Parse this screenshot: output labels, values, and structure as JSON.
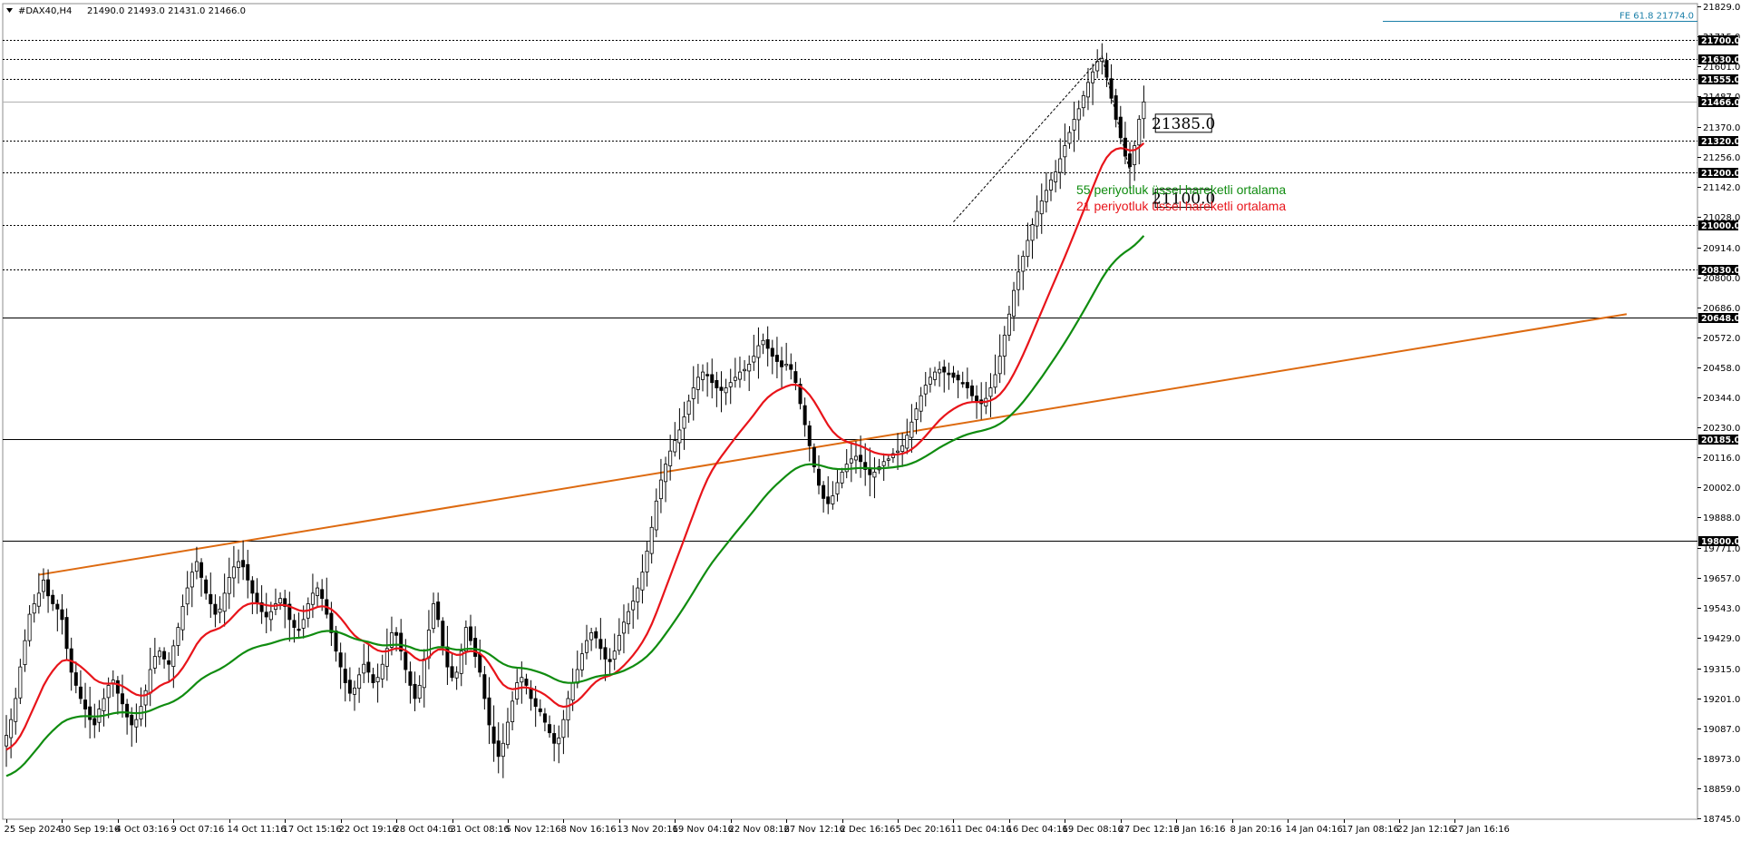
{
  "header": {
    "symbol": "#DAX40,H4",
    "ohlc": "21490.0 21493.0 21431.0 21466.0",
    "collapse_icon": "triangle-down-icon"
  },
  "colors": {
    "ema21": "#e8141a",
    "ema55": "#108c10",
    "trendline": "#dd6a10",
    "fe_line": "#1a7fa8",
    "candle": "#000000",
    "price_box": "#000000"
  },
  "legend": {
    "ema55_label": "55 periyotluk üssel hareketli ortalama",
    "ema21_label": "21 periyotluk üssel hareketli ortalama"
  },
  "annotations": {
    "fe_label": "FE 61.8 21774.0",
    "box_upper": "21385.0",
    "box_lower": "21100.0"
  },
  "chart_data": {
    "type": "candlestick",
    "symbol": "#DAX40",
    "timeframe": "H4",
    "last": {
      "open": 21490.0,
      "high": 21493.0,
      "low": 21431.0,
      "close": 21466.0
    },
    "y_axis": {
      "min": 18745,
      "max": 18829,
      "range": [
        18745.0,
        21829.0
      ],
      "ticks": [
        "21829.0",
        "21715.0",
        "21601.0",
        "21487.0",
        "21370.0",
        "21256.0",
        "21142.0",
        "21028.0",
        "20914.0",
        "20800.0",
        "20686.0",
        "20572.0",
        "20458.0",
        "20344.0",
        "20230.0",
        "20116.0",
        "20002.0",
        "19888.0",
        "19771.0",
        "19657.0",
        "19543.0",
        "19429.0",
        "19315.0",
        "19201.0",
        "19087.0",
        "18973.0",
        "18859.0",
        "18745.0"
      ],
      "tick_values": [
        21829.0,
        21715.0,
        21601.0,
        21487.0,
        21370.0,
        21256.0,
        21142.0,
        21028.0,
        20914.0,
        20800.0,
        20686.0,
        20572.0,
        20458.0,
        20344.0,
        20230.0,
        20116.0,
        20002.0,
        19888.0,
        19771.0,
        19657.0,
        19543.0,
        19429.0,
        19315.0,
        19201.0,
        19087.0,
        18973.0,
        18859.0,
        18745.0
      ]
    },
    "x_axis": {
      "ticks": [
        "25 Sep 2024",
        "30 Sep 19:16",
        "4 Oct 03:16",
        "9 Oct 07:16",
        "14 Oct 11:16",
        "17 Oct 15:16",
        "22 Oct 19:16",
        "28 Oct 04:16",
        "31 Oct 08:16",
        "5 Nov 12:16",
        "8 Nov 16:16",
        "13 Nov 20:16",
        "19 Nov 04:16",
        "22 Nov 08:16",
        "27 Nov 12:16",
        "2 Dec 16:16",
        "5 Dec 20:16",
        "11 Dec 04:16",
        "16 Dec 04:16",
        "19 Dec 08:16",
        "27 Dec 12:16",
        "3 Jan 16:16",
        "8 Jan 20:16",
        "14 Jan 04:16",
        "17 Jan 08:16",
        "22 Jan 12:16",
        "27 Jan 16:16"
      ],
      "tick_bars": [
        0,
        12,
        24,
        36,
        48,
        60,
        72,
        84,
        96,
        108,
        120,
        132,
        144,
        156,
        168,
        180,
        192,
        204,
        216,
        228,
        240,
        252,
        264,
        276,
        288,
        300,
        312
      ]
    },
    "horizontal_levels": [
      {
        "label": "21700.0",
        "value": 21700.0,
        "style": "dotted"
      },
      {
        "label": "21630.0",
        "value": 21630.0,
        "style": "dotted"
      },
      {
        "label": "21555.0",
        "value": 21555.0,
        "style": "dotted"
      },
      {
        "label": "21466.0",
        "value": 21466.0,
        "style": "current-price"
      },
      {
        "label": "21320.0",
        "value": 21320.0,
        "style": "dotted"
      },
      {
        "label": "21200.0",
        "value": 21200.0,
        "style": "dotted"
      },
      {
        "label": "21000.0",
        "value": 21000.0,
        "style": "dotted"
      },
      {
        "label": "20830.0",
        "value": 20830.0,
        "style": "dotted"
      },
      {
        "label": "20648.0",
        "value": 20648.0,
        "style": "solid"
      },
      {
        "label": "20185.0",
        "value": 20185.0,
        "style": "solid"
      },
      {
        "label": "19800.0",
        "value": 19800.0,
        "style": "solid"
      }
    ],
    "fibonacci_extension": {
      "label": "FE 61.8 21774.0",
      "value": 21774.0
    },
    "trendline": {
      "from": {
        "bar": 7,
        "price": 19670
      },
      "to": {
        "bar": 349,
        "price": 20660
      }
    },
    "boxed_labels": [
      {
        "text": "21385.0",
        "value": 21385.0
      },
      {
        "text": "21100.0",
        "value": 21100.0
      }
    ],
    "indicators": [
      {
        "name": "21 periyotluk üssel hareketli ortalama",
        "type": "EMA",
        "period": 21,
        "color": "#e8141a"
      },
      {
        "name": "55 periyotluk üssel hareketli ortalama",
        "type": "EMA",
        "period": 55,
        "color": "#108c10"
      }
    ],
    "closes": [
      19060,
      19120,
      19200,
      19320,
      19420,
      19520,
      19560,
      19600,
      19650,
      19590,
      19560,
      19540,
      19500,
      19390,
      19300,
      19250,
      19200,
      19160,
      19120,
      19100,
      19160,
      19200,
      19250,
      19270,
      19220,
      19180,
      19130,
      19100,
      19120,
      19170,
      19230,
      19310,
      19360,
      19380,
      19350,
      19330,
      19400,
      19470,
      19550,
      19620,
      19680,
      19720,
      19660,
      19600,
      19560,
      19520,
      19540,
      19600,
      19660,
      19700,
      19720,
      19700,
      19650,
      19600,
      19560,
      19530,
      19510,
      19530,
      19560,
      19580,
      19550,
      19500,
      19470,
      19460,
      19500,
      19560,
      19600,
      19620,
      19580,
      19520,
      19450,
      19380,
      19320,
      19260,
      19220,
      19240,
      19290,
      19330,
      19300,
      19260,
      19280,
      19330,
      19390,
      19450,
      19440,
      19380,
      19310,
      19250,
      19200,
      19250,
      19350,
      19460,
      19560,
      19500,
      19400,
      19320,
      19280,
      19300,
      19380,
      19470,
      19420,
      19360,
      19300,
      19200,
      19100,
      19030,
      18980,
      19030,
      19110,
      19190,
      19260,
      19280,
      19250,
      19200,
      19170,
      19150,
      19110,
      19070,
      19030,
      19050,
      19120,
      19200,
      19260,
      19310,
      19370,
      19420,
      19450,
      19430,
      19390,
      19350,
      19340,
      19380,
      19440,
      19490,
      19530,
      19570,
      19620,
      19680,
      19760,
      19850,
      19950,
      20030,
      20090,
      20140,
      20180,
      20220,
      20270,
      20330,
      20380,
      20420,
      20440,
      20430,
      20400,
      20380,
      20370,
      20380,
      20400,
      20420,
      20440,
      20450,
      20470,
      20500,
      20540,
      20560,
      20530,
      20500,
      20480,
      20460,
      20470,
      20450,
      20400,
      20320,
      20240,
      20160,
      20080,
      20010,
      19960,
      19940,
      19970,
      20020,
      20060,
      20090,
      20110,
      20120,
      20100,
      20070,
      20050,
      20060,
      20080,
      20100,
      20110,
      20130,
      20140,
      20160,
      20200,
      20250,
      20300,
      20350,
      20390,
      20420,
      20440,
      20450,
      20440,
      20430,
      20420,
      20410,
      20400,
      20380,
      20350,
      20330,
      20320,
      20340,
      20380,
      20430,
      20500,
      20580,
      20660,
      20750,
      20820,
      20880,
      20940,
      21000,
      21050,
      21090,
      21130,
      21170,
      21200,
      21250,
      21300,
      21350,
      21400,
      21440,
      21490,
      21540,
      21580,
      21620,
      21630,
      21560,
      21480,
      21400,
      21330,
      21260,
      21220,
      21300,
      21400,
      21466
    ]
  }
}
